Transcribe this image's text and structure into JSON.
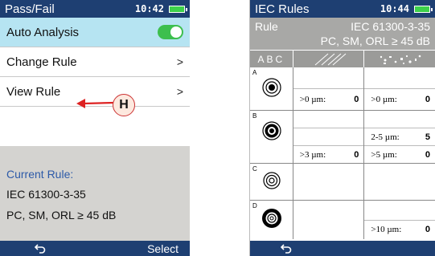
{
  "left_screen": {
    "status": {
      "title": "Pass/Fail",
      "time": "10:42"
    },
    "menu": [
      {
        "label": "Auto Analysis",
        "control": "toggle",
        "state": "on"
      },
      {
        "label": "Change Rule",
        "control": "chevron",
        "chevron": ">"
      },
      {
        "label": "View Rule",
        "control": "chevron",
        "chevron": ">"
      }
    ],
    "current_rule": {
      "title": "Current Rule:",
      "line1": "IEC 61300-3-35",
      "line2": "PC, SM, ORL ≥ 45 dB"
    },
    "bottom_bar": {
      "back_icon": "back-arrow-icon",
      "select_label": "Select"
    },
    "callout": {
      "badge": "H"
    }
  },
  "right_screen": {
    "status": {
      "title": "IEC Rules",
      "time": "10:44"
    },
    "header": {
      "label": "Rule",
      "standard": "IEC 61300-3-35",
      "params": "PC, SM, ORL ≥ 45 dB"
    },
    "column_header": {
      "zones_label": "ABC",
      "col1_icon": "scratch-icon",
      "col2_icon": "defect-icon"
    },
    "zones": [
      {
        "letter": "A",
        "scratches": [
          "",
          {
            "size": ">0 µm:",
            "count": "0"
          }
        ],
        "defects": [
          "",
          {
            "size": ">0 µm:",
            "count": "0"
          }
        ]
      },
      {
        "letter": "B",
        "scratches": [
          "",
          "",
          {
            "size": ">3 µm:",
            "count": "0"
          }
        ],
        "defects": [
          "",
          {
            "size": "2-5 µm:",
            "count": "5"
          },
          {
            "size": ">5 µm:",
            "count": "0"
          }
        ]
      },
      {
        "letter": "C",
        "scratches": [
          ""
        ],
        "defects": [
          ""
        ]
      },
      {
        "letter": "D",
        "scratches": [
          ""
        ],
        "defects": [
          "",
          {
            "size": ">10 µm:",
            "count": "0"
          }
        ]
      }
    ],
    "bottom_bar": {
      "back_icon": "back-arrow-icon"
    }
  },
  "colors": {
    "bar": "#1e3f72",
    "highlight": "#b6e4f2",
    "toggle_on": "#3dbf4e",
    "accent_text": "#2d5aa8",
    "callout": "#cc3333"
  }
}
